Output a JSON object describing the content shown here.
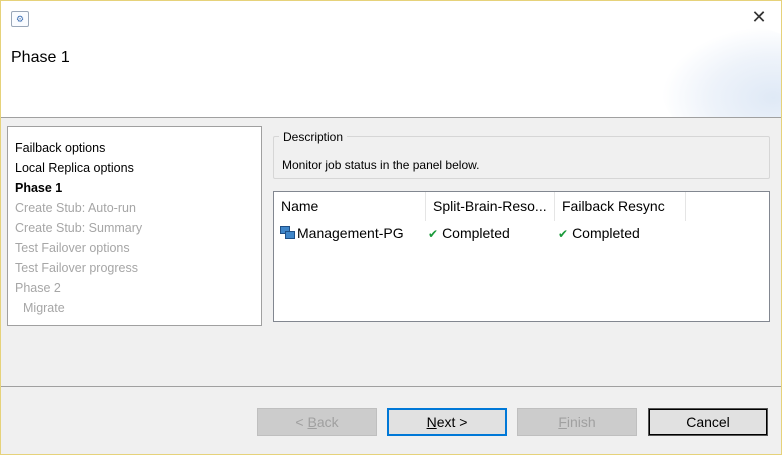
{
  "wizard": {
    "title": "Phase 1"
  },
  "steps": [
    {
      "label": "Failback options",
      "state": "done"
    },
    {
      "label": "Local Replica options",
      "state": "done"
    },
    {
      "label": "Phase 1",
      "state": "current"
    },
    {
      "label": "Create Stub: Auto-run",
      "state": "disabled"
    },
    {
      "label": "Create Stub: Summary",
      "state": "disabled"
    },
    {
      "label": "Test Failover  options",
      "state": "disabled"
    },
    {
      "label": "Test Failover  progress",
      "state": "disabled"
    },
    {
      "label": "Phase 2",
      "state": "disabled"
    },
    {
      "label": "Migrate",
      "state": "disabled"
    }
  ],
  "description": {
    "legend": "Description",
    "text": "Monitor job status in the panel below."
  },
  "jobs": {
    "columns": [
      "Name",
      "Split-Brain-Reso...",
      "Failback Resync"
    ],
    "rows": [
      {
        "name": "Management-PG",
        "split_brain": "Completed",
        "failback_resync": "Completed"
      }
    ]
  },
  "buttons": {
    "back": {
      "pre": "< ",
      "key": "B",
      "post": "ack"
    },
    "next": {
      "key": "N",
      "post": "ext >"
    },
    "finish": {
      "key": "F",
      "post": "inish"
    },
    "cancel": "Cancel"
  },
  "icons": {
    "app": "wizard-app-icon",
    "close": "close-icon",
    "vm": "vm-group-icon",
    "status": "check-icon"
  },
  "colors": {
    "check_green": "#1a9a3a",
    "default_button_border": "#0078d7"
  }
}
